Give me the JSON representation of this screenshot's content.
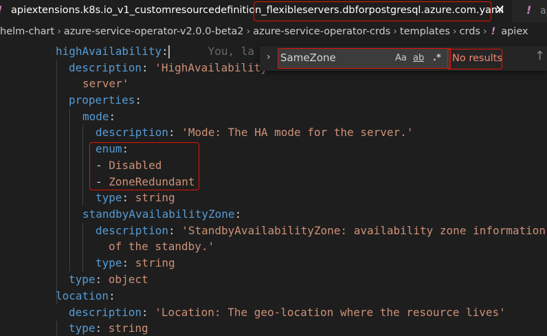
{
  "tabs": {
    "active": {
      "prefix": "apiextensions.k8s.io_v1_customresourcedefinition_",
      "highlight": "flexibleservers.dbforpostgresql.azure.com.yaml",
      "close": "✕"
    },
    "next": "ap"
  },
  "breadcrumb": [
    "helm-chart",
    "azure-service-operator-v2.0.0-beta2",
    "azure-service-operator-crds",
    "templates",
    "crds"
  ],
  "breadcrumb_file": "apiex",
  "editor": {
    "ghost": "You, la",
    "lines": {
      "l1": {
        "key": "highAvailability"
      },
      "l2": {
        "key": "description",
        "value": "'HighAvailability"
      },
      "l3": {
        "value": "server'"
      },
      "l4": {
        "key": "properties"
      },
      "l5": {
        "key": "mode"
      },
      "l6": {
        "key": "description",
        "value": "'Mode: The HA mode for the server.'"
      },
      "l7": {
        "key": "enum"
      },
      "l8": {
        "value": "Disabled"
      },
      "l9": {
        "value": "ZoneRedundant"
      },
      "l10": {
        "key": "type",
        "value": "string"
      },
      "l11": {
        "key": "standbyAvailabilityZone"
      },
      "l12": {
        "key": "description",
        "value": "'StandbyAvailabilityZone: availability zone information"
      },
      "l13": {
        "value": "of the standby.'"
      },
      "l14": {
        "key": "type",
        "value": "string"
      },
      "l15": {
        "key": "type",
        "value": "object"
      },
      "l16": {
        "key": "location"
      },
      "l17": {
        "key": "description",
        "value": "'Location: The geo-location where the resource lives'"
      },
      "l18": {
        "key": "type",
        "value": "string"
      }
    }
  },
  "find": {
    "query": "SameZone",
    "match_case": "Aa",
    "whole_word": "ab",
    "regex": ".*",
    "results": "No results"
  },
  "icons": {
    "tab_warning": "!",
    "chevron": "›",
    "find_toggle": "›",
    "find_up": "↑"
  }
}
